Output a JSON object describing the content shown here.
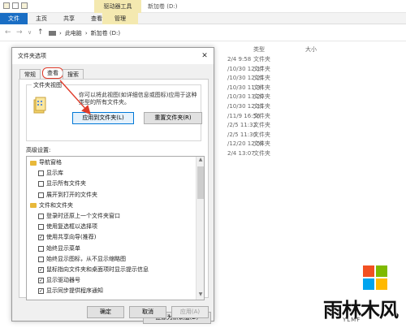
{
  "explorer": {
    "context_tab": "驱动器工具",
    "window_title": "新加卷 (D:)",
    "ribbon_tabs": [
      "文件",
      "主页",
      "共享",
      "查看",
      "管理"
    ],
    "breadcrumb": [
      "此电脑",
      "新加卷 (D:)"
    ],
    "columns": {
      "type": "类型",
      "size": "大小"
    },
    "rows": [
      {
        "date": "2/4 9:58",
        "type": "文件夹"
      },
      {
        "date": "/10/30 12:17",
        "type": "文件夹"
      },
      {
        "date": "/10/30 12:21",
        "type": "文件夹"
      },
      {
        "date": "/10/30 11:34",
        "type": "文件夹"
      },
      {
        "date": "/10/30 13:20",
        "type": "文件夹"
      },
      {
        "date": "/10/30 12:11",
        "type": "文件夹"
      },
      {
        "date": "/11/9 16:56",
        "type": "文件夹"
      },
      {
        "date": "/2/5 11:32",
        "type": "文件夹"
      },
      {
        "date": "/2/5 11:30",
        "type": "文件夹"
      },
      {
        "date": "/12/20 12:58",
        "type": "文件夹"
      },
      {
        "date": "2/4 13:07",
        "type": "文件夹"
      }
    ]
  },
  "dialog": {
    "title": "文件夹选项",
    "close": "✕",
    "tabs": [
      "常规",
      "查看",
      "搜索"
    ],
    "folder_views_label": "文件夹视图",
    "folder_views_desc": "你可以将此视图(如详细信息或图标)应用于这种类型的所有文件夹。",
    "apply_to_folders": "应用到文件夹(L)",
    "reset_folders": "重置文件夹(R)",
    "advanced_label": "高级设置:",
    "tree": [
      {
        "kind": "folder",
        "text": "导航窗格",
        "indent": 0
      },
      {
        "kind": "check",
        "checked": false,
        "text": "显示库",
        "indent": 1
      },
      {
        "kind": "check",
        "checked": false,
        "text": "显示所有文件夹",
        "indent": 1
      },
      {
        "kind": "check",
        "checked": false,
        "text": "展开到打开的文件夹",
        "indent": 1
      },
      {
        "kind": "folder",
        "text": "文件和文件夹",
        "indent": 0
      },
      {
        "kind": "check",
        "checked": false,
        "text": "登录时还原上一个文件夹窗口",
        "indent": 1
      },
      {
        "kind": "check",
        "checked": false,
        "text": "使用复选框以选择项",
        "indent": 1
      },
      {
        "kind": "check",
        "checked": true,
        "text": "使用共享向导(推荐)",
        "indent": 1
      },
      {
        "kind": "check",
        "checked": false,
        "text": "始终显示菜单",
        "indent": 1
      },
      {
        "kind": "check",
        "checked": false,
        "text": "始终显示图标，从不显示缩略图",
        "indent": 1
      },
      {
        "kind": "check",
        "checked": true,
        "text": "鼠标指向文件夹和桌面项时显示提示信息",
        "indent": 1
      },
      {
        "kind": "check",
        "checked": true,
        "text": "显示驱动器号",
        "indent": 1
      },
      {
        "kind": "check",
        "checked": true,
        "text": "显示同步提供程序通知",
        "indent": 1
      }
    ],
    "restore_defaults": "还原为默认值(D)",
    "ok": "确定",
    "cancel": "取消",
    "apply": "应用(A)"
  },
  "watermark": {
    "brand": "雨林木风",
    "sub": "YLMF",
    "colors": [
      "#f25022",
      "#7fba00",
      "#00a4ef",
      "#ffb900"
    ]
  },
  "accent": "#e03b2a"
}
